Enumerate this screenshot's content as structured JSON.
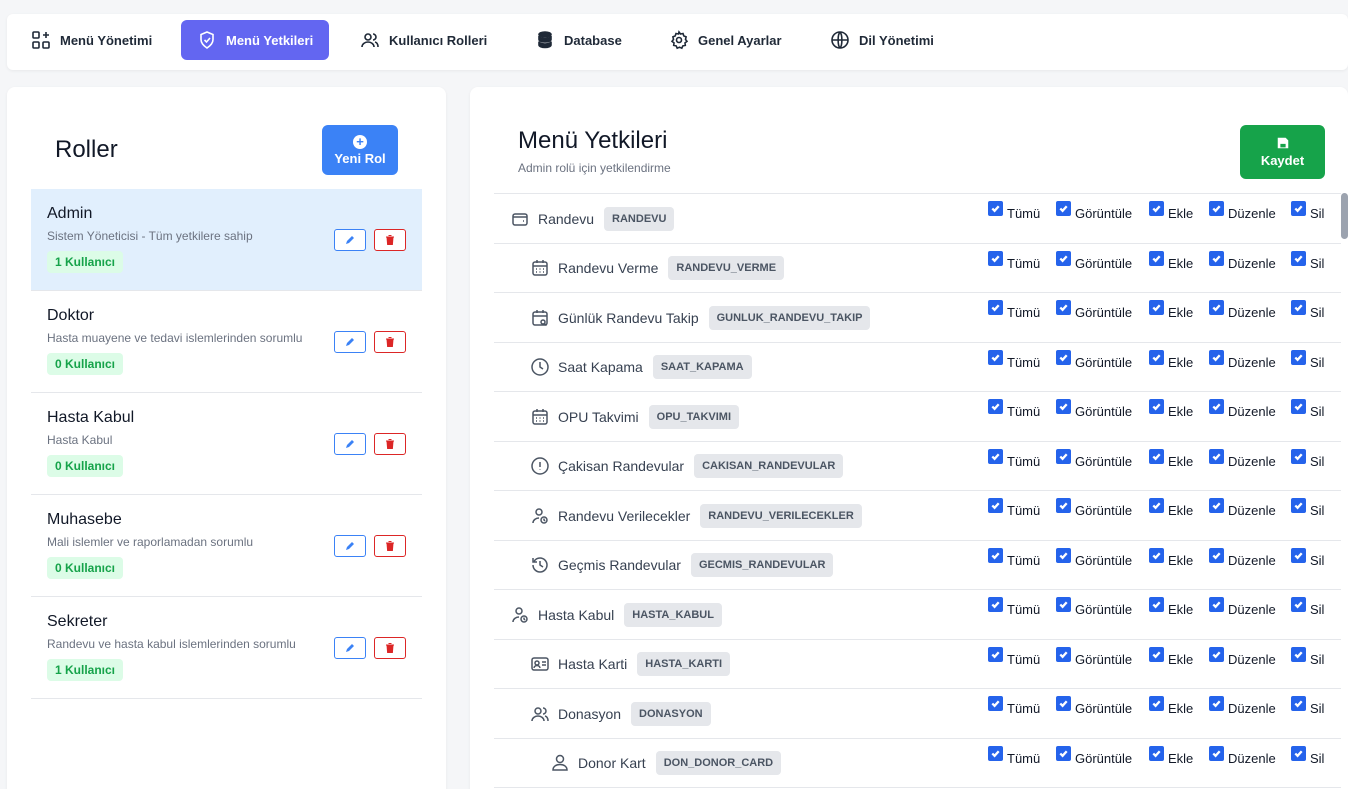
{
  "nav": {
    "tabs": [
      {
        "label": "Menü Yönetimi",
        "icon": "grid-plus-icon"
      },
      {
        "label": "Menü Yetkileri",
        "icon": "shield-check-icon",
        "active": true
      },
      {
        "label": "Kullanıcı Rolleri",
        "icon": "users-icon"
      },
      {
        "label": "Database",
        "icon": "database-icon"
      },
      {
        "label": "Genel Ayarlar",
        "icon": "gear-icon"
      },
      {
        "label": "Dil Yönetimi",
        "icon": "globe-icon"
      }
    ]
  },
  "roles": {
    "title": "Roller",
    "new_button": "Yeni Rol",
    "items": [
      {
        "name": "Admin",
        "desc": "Sistem Yöneticisi - Tüm yetkilere sahip",
        "count": "1 Kullanıcı",
        "selected": true
      },
      {
        "name": "Doktor",
        "desc": "Hasta muayene ve tedavi islemlerinden sorumlu",
        "count": "0 Kullanıcı"
      },
      {
        "name": "Hasta Kabul",
        "desc": "Hasta Kabul",
        "count": "0 Kullanıcı"
      },
      {
        "name": "Muhasebe",
        "desc": "Mali islemler ve raporlamadan sorumlu",
        "count": "0 Kullanıcı"
      },
      {
        "name": "Sekreter",
        "desc": "Randevu ve hasta kabul islemlerinden sorumlu",
        "count": "1 Kullanıcı"
      }
    ]
  },
  "permissions": {
    "title": "Menü Yetkileri",
    "subtitle": "Admin rolü için yetkilendirme",
    "save_button": "Kaydet",
    "columns": [
      "Tümü",
      "Görüntüle",
      "Ekle",
      "Düzenle",
      "Sil"
    ],
    "rows": [
      {
        "label": "Randevu",
        "code": "RANDEVU",
        "level": 0,
        "icon": "wallet-icon"
      },
      {
        "label": "Randevu Verme",
        "code": "RANDEVU_VERME",
        "level": 1,
        "icon": "calendar-icon"
      },
      {
        "label": "Günlük Randevu Takip",
        "code": "GUNLUK_RANDEVU_TAKIP",
        "level": 1,
        "icon": "calendar-search-icon"
      },
      {
        "label": "Saat Kapama",
        "code": "SAAT_KAPAMA",
        "level": 1,
        "icon": "clock-icon"
      },
      {
        "label": "OPU Takvimi",
        "code": "OPU_TAKVIMI",
        "level": 1,
        "icon": "calendar-icon"
      },
      {
        "label": "Çakisan Randevular",
        "code": "CAKISAN_RANDEVULAR",
        "level": 1,
        "icon": "alert-circle-icon"
      },
      {
        "label": "Randevu Verilecekler",
        "code": "RANDEVU_VERILECEKLER",
        "level": 1,
        "icon": "user-clock-icon"
      },
      {
        "label": "Geçmis Randevular",
        "code": "GECMIS_RANDEVULAR",
        "level": 1,
        "icon": "history-icon"
      },
      {
        "label": "Hasta Kabul",
        "code": "HASTA_KABUL",
        "level": 0,
        "icon": "user-clock-icon"
      },
      {
        "label": "Hasta Karti",
        "code": "HASTA_KARTI",
        "level": 1,
        "icon": "id-card-icon"
      },
      {
        "label": "Donasyon",
        "code": "DONASYON",
        "level": 1,
        "icon": "users-icon"
      },
      {
        "label": "Donor Kart",
        "code": "DON_DONOR_CARD",
        "level": 2,
        "icon": "user-icon"
      }
    ]
  }
}
